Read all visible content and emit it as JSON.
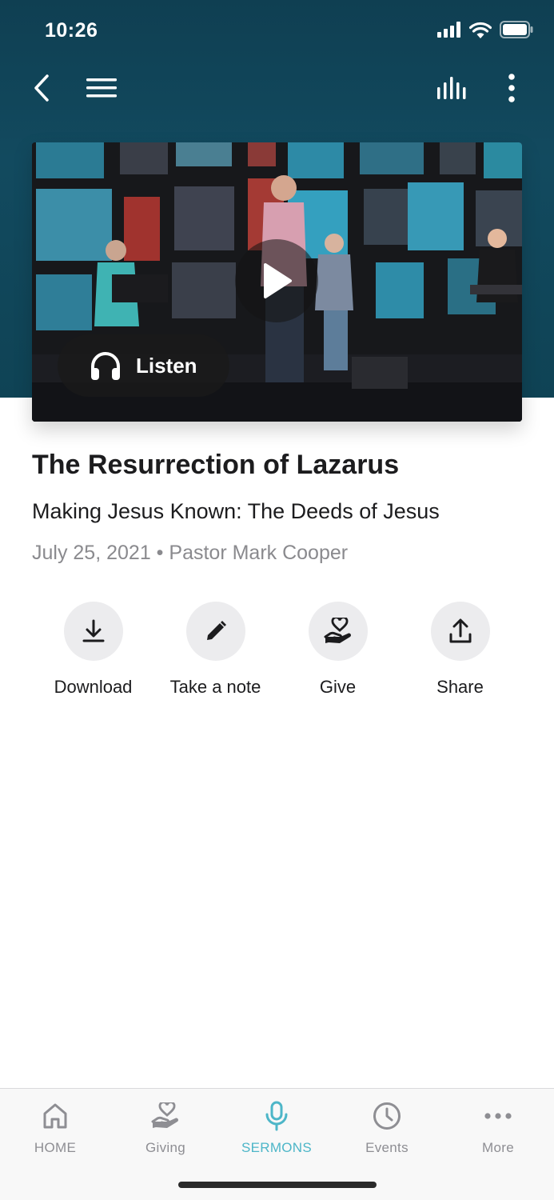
{
  "status_bar": {
    "time": "10:26",
    "icons": [
      "signal-icon",
      "wifi-icon",
      "battery-icon"
    ]
  },
  "nav": {
    "icons": [
      "back-icon",
      "menu-icon",
      "audio-bars-icon",
      "more-vertical-icon"
    ]
  },
  "hero": {
    "listen_label": "Listen",
    "icons": [
      "play-icon",
      "headphones-icon"
    ]
  },
  "sermon": {
    "title": "The Resurrection of Lazarus",
    "series": "Making Jesus Known: The Deeds of Jesus",
    "date": "July 25, 2021",
    "separator": "•",
    "speaker": "Pastor Mark Cooper"
  },
  "actions": [
    {
      "label": "Download",
      "icon": "download-icon"
    },
    {
      "label": "Take a note",
      "icon": "pencil-icon"
    },
    {
      "label": "Give",
      "icon": "heart-hand-icon"
    },
    {
      "label": "Share",
      "icon": "share-icon"
    }
  ],
  "tabbar": {
    "tabs": [
      {
        "label": "HOME",
        "icon": "home-icon",
        "active": false
      },
      {
        "label": "Giving",
        "icon": "heart-hand-icon",
        "active": false
      },
      {
        "label": "SERMONS",
        "icon": "microphone-icon",
        "active": true
      },
      {
        "label": "Events",
        "icon": "clock-icon",
        "active": false
      },
      {
        "label": "More",
        "icon": "more-horizontal-icon",
        "active": false
      }
    ]
  },
  "colors": {
    "header": "#124a5f",
    "accent": "#4db6c8",
    "inactive": "#8e8e93",
    "action_bg": "#ececee"
  }
}
